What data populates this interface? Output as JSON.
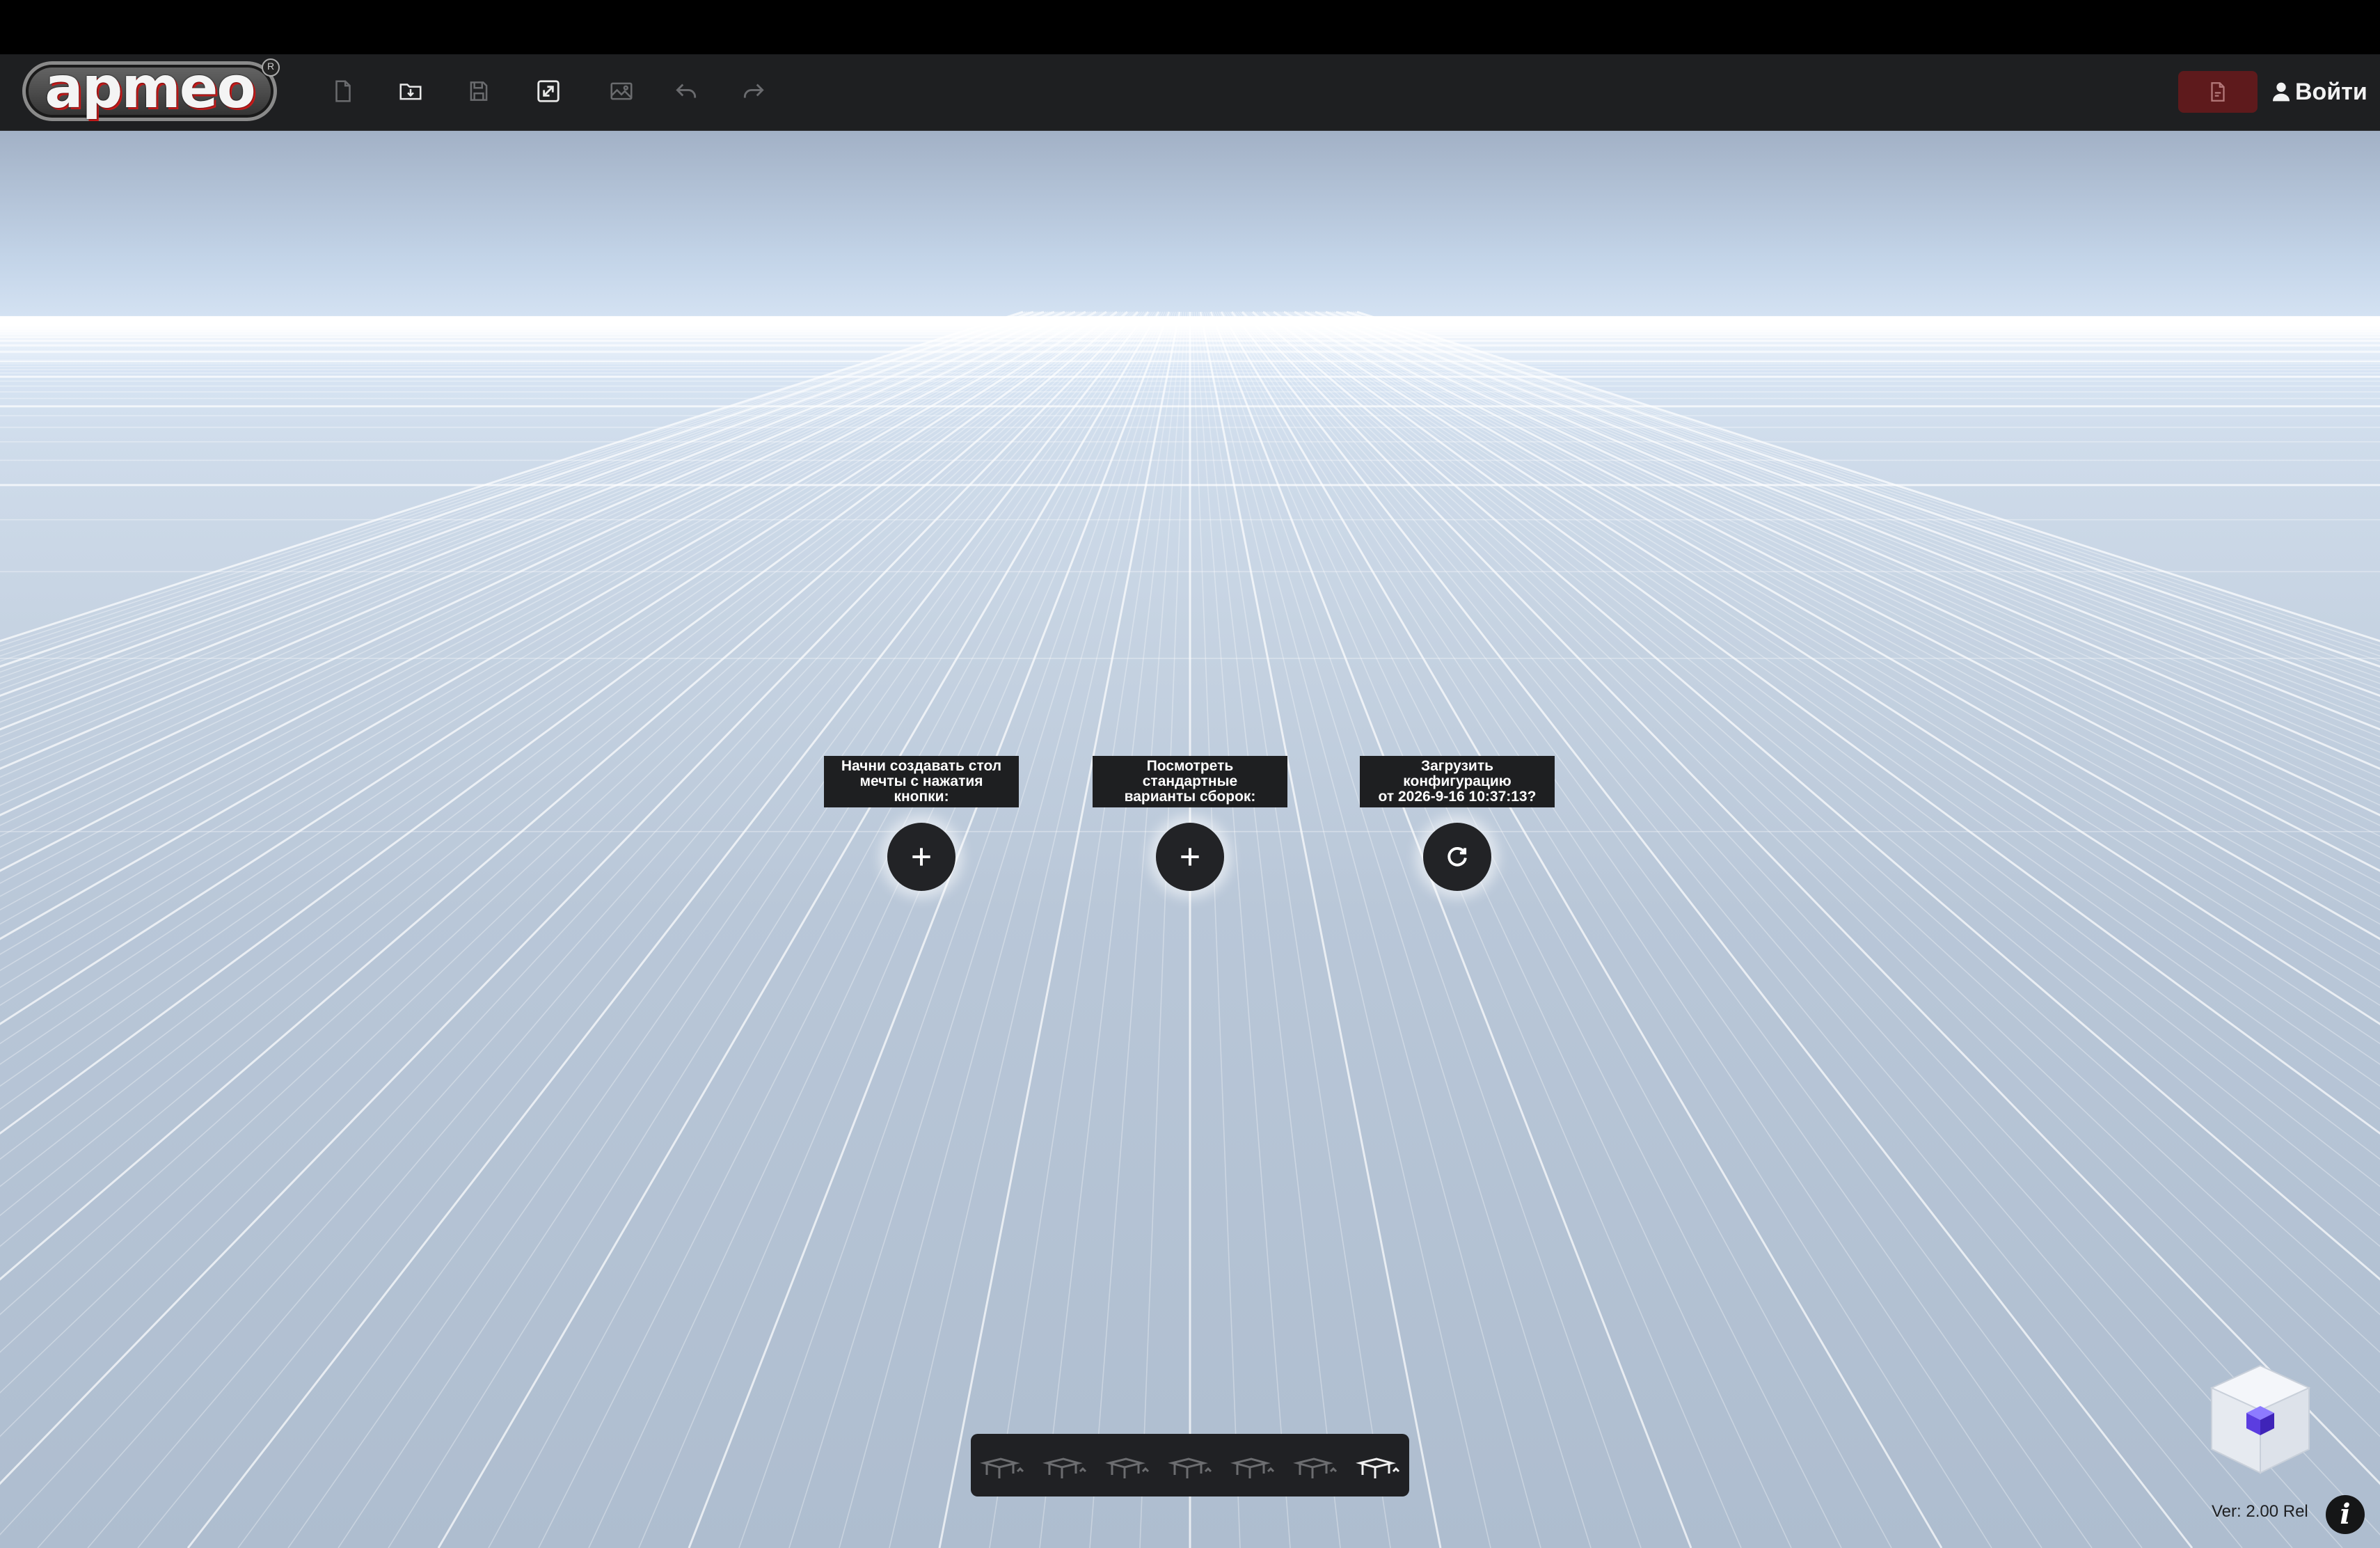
{
  "logo": {
    "text": "apmeo",
    "reg": "R"
  },
  "toolbar": {
    "tools": [
      {
        "icon": "new-file-icon",
        "enabled": false
      },
      {
        "icon": "open-folder-icon",
        "enabled": true
      },
      {
        "icon": "save-icon",
        "enabled": false
      },
      {
        "icon": "fullscreen-icon",
        "enabled": true
      },
      {
        "icon": "image-icon",
        "enabled": false
      },
      {
        "icon": "undo-icon",
        "enabled": false
      },
      {
        "icon": "redo-icon",
        "enabled": false
      }
    ],
    "pdf_icon": "pdf-icon",
    "login_label": "Войти"
  },
  "prompts": [
    {
      "text": "Начни создавать стол\nмечты с нажатия кнопки:",
      "icon": "plus-icon"
    },
    {
      "text": "Посмотреть стандартные\nварианты сборок:",
      "icon": "plus-icon"
    },
    {
      "text": "Загрузить конфигурацию\nот 2026-9-16 10:37:13?",
      "icon": "reload-icon"
    }
  ],
  "bottom_bar": {
    "items": [
      {
        "icon": "desk-view-1-icon",
        "active": false
      },
      {
        "icon": "desk-view-2-icon",
        "active": false
      },
      {
        "icon": "desk-view-3-icon",
        "active": false
      },
      {
        "icon": "desk-view-4-icon",
        "active": false
      },
      {
        "icon": "desk-view-5-icon",
        "active": false
      },
      {
        "icon": "desk-view-6-icon",
        "active": false
      },
      {
        "icon": "desk-view-7-icon",
        "active": true
      }
    ]
  },
  "version": "Ver: 2.00 Rel",
  "info_label": "i",
  "colors": {
    "toolbar": "#1e1f21",
    "pdf_button": "#5e1a1c",
    "cube_face": "#5b3de0"
  }
}
